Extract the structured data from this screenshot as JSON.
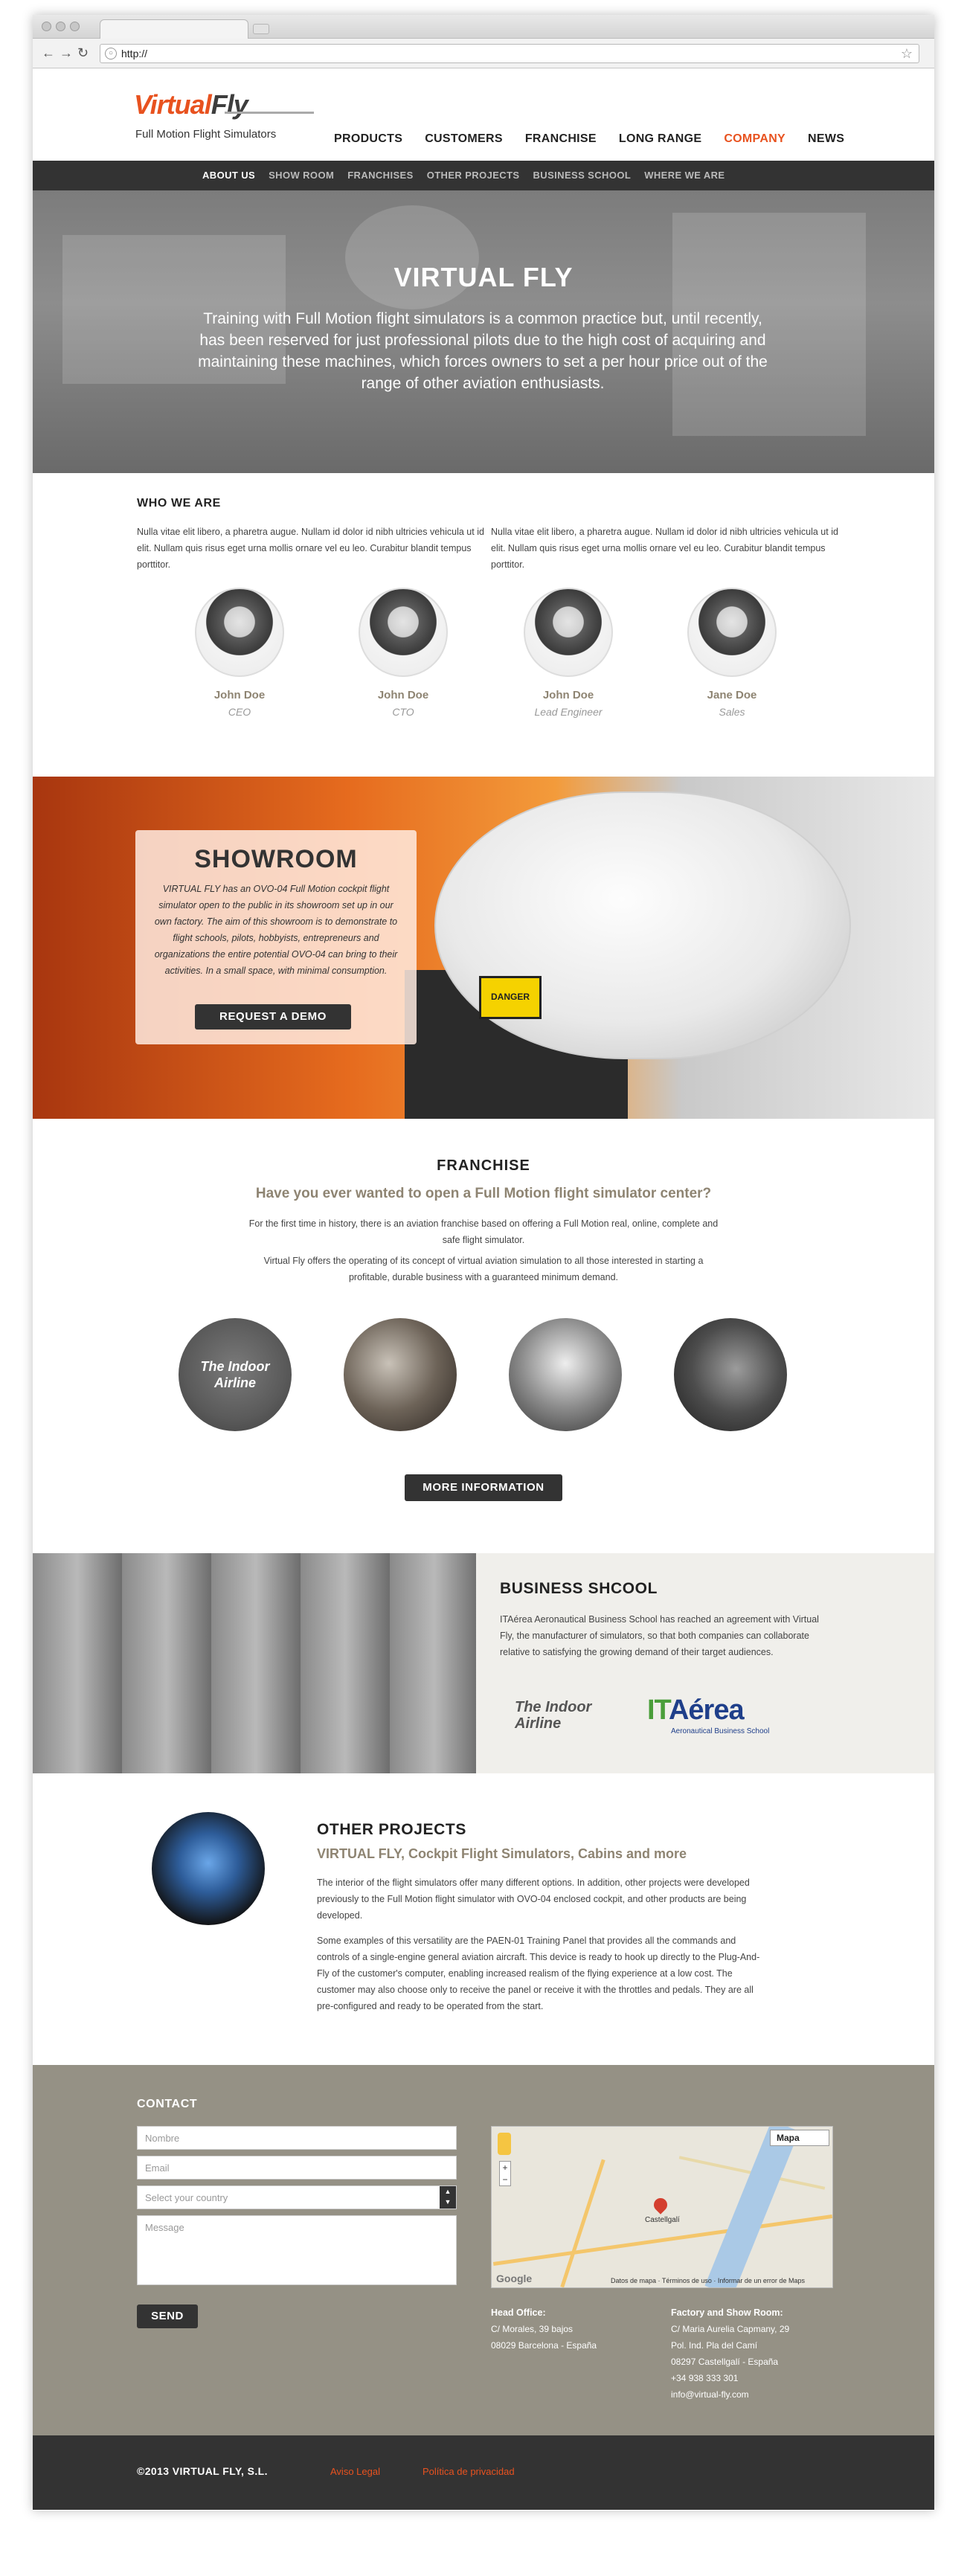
{
  "browser": {
    "url": "http://",
    "back_icon": "back-arrow-icon",
    "forward_icon": "forward-arrow-icon",
    "reload_icon": "reload-icon"
  },
  "header": {
    "logo_virtual": "Virtual",
    "logo_fly": "Fly",
    "tagline": "Full Motion Flight Simulators",
    "nav": [
      "PRODUCTS",
      "CUSTOMERS",
      "FRANCHISE",
      "LONG RANGE",
      "COMPANY",
      "NEWS"
    ],
    "subnav": [
      "ABOUT US",
      "SHOW ROOM",
      "FRANCHISES",
      "OTHER PROJECTS",
      "BUSINESS SCHOOL",
      "WHERE WE ARE"
    ]
  },
  "hero": {
    "title": "VIRTUAL FLY",
    "text": "Training with Full Motion flight simulators is a common practice but, until recently, has been reserved for just professional pilots due to the high cost of acquiring and maintaining these machines, which forces owners to set a per hour price out of the range of other aviation enthusiasts."
  },
  "who": {
    "heading": "WHO WE ARE",
    "p1": "Nulla vitae elit libero, a pharetra augue. Nullam id dolor id nibh ultricies vehicula ut id elit. Nullam quis risus eget urna mollis ornare vel eu leo. Curabitur blandit tempus porttitor.",
    "p2": "Nulla vitae elit libero, a pharetra augue. Nullam id dolor id nibh ultricies vehicula ut id elit. Nullam quis risus eget urna mollis ornare vel eu leo. Curabitur blandit tempus porttitor.",
    "team": [
      {
        "name": "John Doe",
        "role": "CEO"
      },
      {
        "name": "John Doe",
        "role": "CTO"
      },
      {
        "name": "John Doe",
        "role": "Lead Engineer"
      },
      {
        "name": "Jane Doe",
        "role": "Sales"
      }
    ]
  },
  "showroom": {
    "title": "SHOWROOM",
    "text": "VIRTUAL FLY has an OVO-04 Full Motion cockpit flight simulator open to the public in its showroom set up in our own factory. The aim of this showroom is to demonstrate to flight schools, pilots, hobbyists, entrepreneurs and organizations the entire potential OVO-04 can bring to their activities. In a small space, with minimal consumption.",
    "button": "REQUEST A DEMO",
    "danger_label": "DANGER"
  },
  "franchise": {
    "heading": "FRANCHISE",
    "subheading": "Have you ever wanted to open a Full Motion flight simulator center?",
    "p1": "For the first time in history, there is an aviation franchise based on offering a Full Motion real, online, complete and safe flight simulator.",
    "p2": "Virtual Fly offers the operating of its concept of virtual aviation simulation to all those interested in starting a profitable, durable business with a guaranteed minimum demand.",
    "circle1_label": "The Indoor Airline",
    "button": "MORE INFORMATION"
  },
  "business": {
    "heading": "BUSINESS SHCOOL",
    "text": "ITAérea Aeronautical Business School has reached an agreement with Virtual Fly, the manufacturer of simulators, so that both companies can collaborate relative to satisfying the growing demand of their target audiences.",
    "logo1_line1": "The Indoor",
    "logo1_line2": "Airline",
    "logo2_it": "IT",
    "logo2_rest": "Aérea",
    "logo2_sub": "Aeronautical Business School"
  },
  "other_projects": {
    "heading": "OTHER PROJECTS",
    "subheading": "VIRTUAL FLY, Cockpit Flight Simulators, Cabins and more",
    "p1": "The interior of the flight simulators offer many different options. In addition, other projects were developed previously to the Full Motion flight simulator with OVO-04 enclosed cockpit, and other products are being developed.",
    "p2": "Some examples of this versatility are the PAEN-01 Training Panel that provides all the commands and controls of a single-engine general aviation aircraft. This device is ready to hook up directly to the Plug-And-Fly of the customer's computer, enabling increased realism of the flying experience at a low cost. The customer may also choose only to receive the panel or receive it with the throttles and pedals. They are all pre-configured and ready to be operated from the start."
  },
  "contact": {
    "heading": "CONTACT",
    "name_placeholder": "Nombre",
    "email_placeholder": "Email",
    "country_placeholder": "Select your country",
    "message_placeholder": "Message",
    "send": "SEND",
    "map_type": "Mapa",
    "map_town": "Castellgalí",
    "map_footer": "Datos de mapa · Términos de uso · Informar de un error de Maps",
    "map_google": "Google",
    "head_office_title": "Head Office:",
    "head_office_lines": [
      "C/ Morales, 39 bajos",
      "08029 Barcelona - España"
    ],
    "factory_title": "Factory and Show Room:",
    "factory_lines": [
      "C/ Maria Aurelia Capmany, 29",
      "Pol. Ind. Pla del Camí",
      "08297 Castellgalí - España",
      "+34 938 333 301",
      "info@virtual-fly.com"
    ]
  },
  "footer": {
    "copyright": "©2013 VIRTUAL FLY, S.L.",
    "legal": "Aviso Legal",
    "privacy": "Política de privacidad"
  },
  "colors": {
    "accent": "#e8521f",
    "taupe": "#8e8472",
    "dark": "#333333",
    "contact_bg": "#959185"
  }
}
